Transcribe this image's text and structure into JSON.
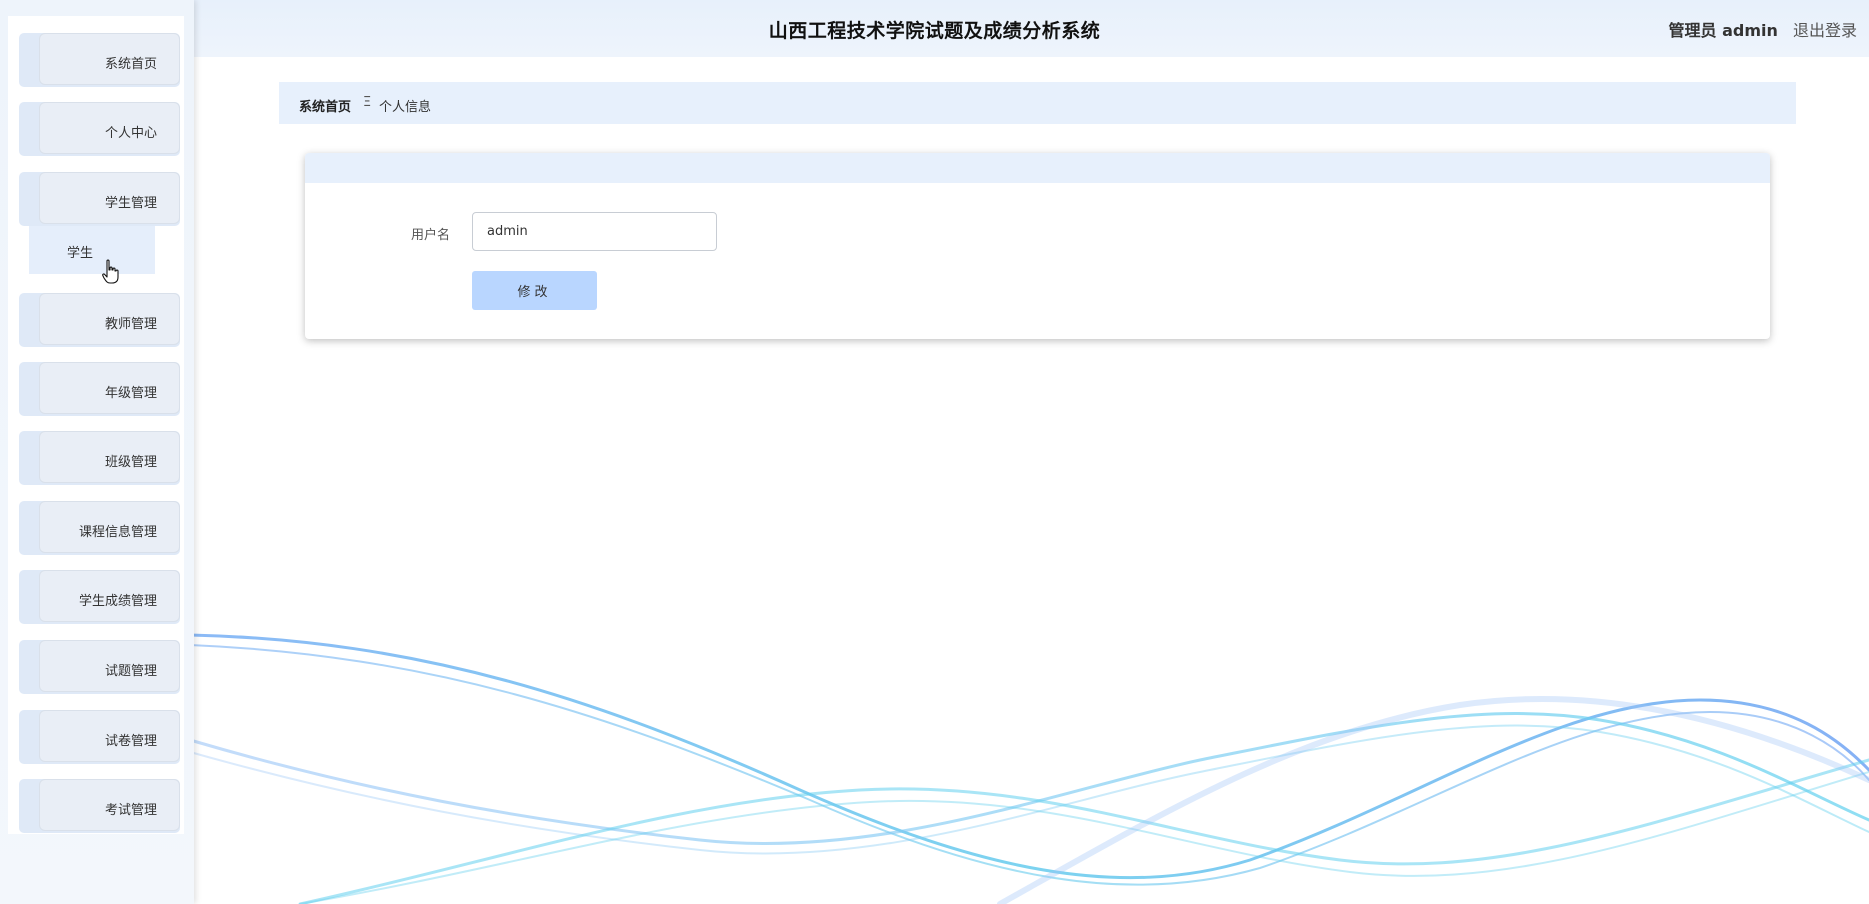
{
  "header": {
    "title": "山西工程技术学院试题及成绩分析系统",
    "user": "管理员 admin",
    "logout": "退出登录"
  },
  "sidebar": {
    "items": [
      {
        "label": "系统首页"
      },
      {
        "label": "个人中心"
      },
      {
        "label": "学生管理"
      },
      {
        "label": "教师管理"
      },
      {
        "label": "年级管理"
      },
      {
        "label": "班级管理"
      },
      {
        "label": "课程信息管理"
      },
      {
        "label": "学生成绩管理"
      },
      {
        "label": "试题管理"
      },
      {
        "label": "试卷管理"
      },
      {
        "label": "考试管理"
      }
    ],
    "submenu": {
      "label": "学生"
    }
  },
  "breadcrumb": {
    "home": "系统首页",
    "separator": "Ξ",
    "current": "个人信息"
  },
  "form": {
    "username_label": "用户名",
    "username_value": "admin",
    "submit_label": "修改"
  },
  "colors": {
    "header_bg": "#e7f0fb",
    "menu_item_bg": "#dfe9f7",
    "breadcrumb_bg": "#e7f0fc",
    "button_bg": "#b9d6ff"
  }
}
